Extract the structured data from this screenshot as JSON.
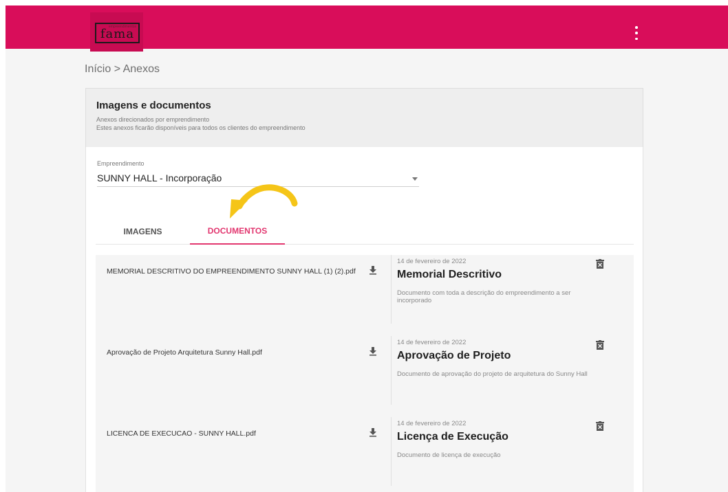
{
  "header": {
    "logo_text": "fama",
    "logo_small_text": "empreendimentos",
    "menu_icon": "kebab-menu-icon",
    "background_color": "#d90d5a"
  },
  "breadcrumb": {
    "text": "Início > Anexos"
  },
  "section": {
    "title": "Imagens e documentos",
    "subtitle_1": "Anexos direcionados por emprendimento",
    "subtitle_2": "Estes anexos ficarão disponíveis para todos os clientes do empreendimento"
  },
  "select": {
    "label": "Empreendimento",
    "value": "SUNNY HALL - Incorporação"
  },
  "tabs": {
    "images": "IMAGENS",
    "documents": "DOCUMENTOS",
    "active": "documents",
    "accent_color": "#e2366f"
  },
  "documents": [
    {
      "filename": "MEMORIAL DESCRITIVO DO EMPREENDIMENTO SUNNY HALL (1) (2).pdf",
      "date": "14 de fevereiro de 2022",
      "title": "Memorial Descritivo",
      "description": "Documento com toda a descrição do empreendimento a ser incorporado"
    },
    {
      "filename": "Aprovação de Projeto Arquitetura Sunny Hall.pdf",
      "date": "14 de fevereiro de 2022",
      "title": "Aprovação de Projeto",
      "description": "Documento de aprovação do projeto de arquitetura do Sunny Hall"
    },
    {
      "filename": "LICENCA DE EXECUCAO - SUNNY HALL.pdf",
      "date": "14 de fevereiro de 2022",
      "title": "Licença de Execução",
      "description": "Documento de licença de execução"
    }
  ],
  "icons": {
    "download": "download-icon",
    "delete": "trash-icon",
    "annotation": "curved-arrow-icon",
    "annotation_color": "#f5c518"
  }
}
